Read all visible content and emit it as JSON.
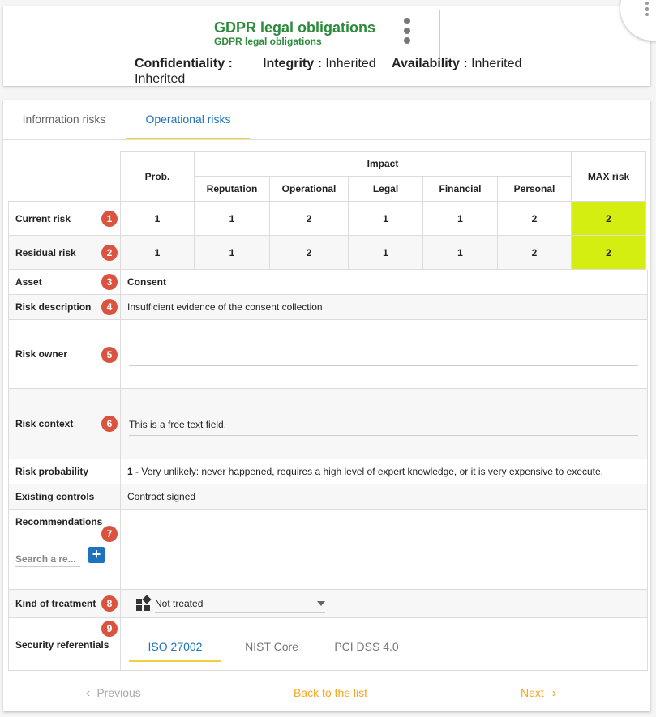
{
  "header": {
    "title": "GDPR legal obligations",
    "subtitle": "GDPR legal obligations",
    "confidentiality_label": "Confidentiality :",
    "confidentiality_value": "Inherited",
    "integrity_label": "Integrity :",
    "integrity_value": "Inherited",
    "availability_label": "Availability :",
    "availability_value": "Inherited"
  },
  "tabs": [
    {
      "label": "Information risks",
      "active": false
    },
    {
      "label": "Operational risks",
      "active": true
    }
  ],
  "risk_table": {
    "prob_header": "Prob.",
    "impact_header": "Impact",
    "max_header": "MAX risk",
    "impact_columns": [
      "Reputation",
      "Operational",
      "Legal",
      "Financial",
      "Personal"
    ],
    "rows": [
      {
        "label": "Current risk",
        "badge": "1",
        "prob": "1",
        "impacts": [
          "1",
          "2",
          "1",
          "1",
          "2"
        ],
        "max": "2"
      },
      {
        "label": "Residual risk",
        "badge": "2",
        "prob": "1",
        "impacts": [
          "1",
          "2",
          "1",
          "1",
          "2"
        ],
        "max": "2"
      }
    ]
  },
  "details": {
    "asset_label": "Asset",
    "asset_badge": "3",
    "asset_value": "Consent",
    "desc_label": "Risk description",
    "desc_badge": "4",
    "desc_value": "Insufficient evidence of the consent collection",
    "owner_label": "Risk owner",
    "owner_badge": "5",
    "owner_value": "",
    "context_label": "Risk context",
    "context_badge": "6",
    "context_value": "This is a free text field.",
    "prob_label": "Risk probability",
    "prob_value_num": "1",
    "prob_value_text": " - Very unlikely: never happened, requires a high level of expert knowledge, or it is very expensive to execute.",
    "controls_label": "Existing controls",
    "controls_value": "Contract signed",
    "rec_label": "Recommendations",
    "rec_badge": "7",
    "rec_search_placeholder": "Search a re...",
    "treatment_label": "Kind of treatment",
    "treatment_badge": "8",
    "treatment_value": "Not treated",
    "ref_label": "Security referentials",
    "ref_badge": "9",
    "ref_tabs": [
      "ISO 27002",
      "NIST Core",
      "PCI DSS 4.0"
    ]
  },
  "footer": {
    "previous": "Previous",
    "back": "Back to the list",
    "next": "Next"
  },
  "colors": {
    "accent": "#1e73be",
    "title_green": "#2e8b3c",
    "max_risk": "#d4ee12",
    "badge": "#d9533f",
    "tab_underline": "#f0d040",
    "orange": "#f5a623"
  }
}
